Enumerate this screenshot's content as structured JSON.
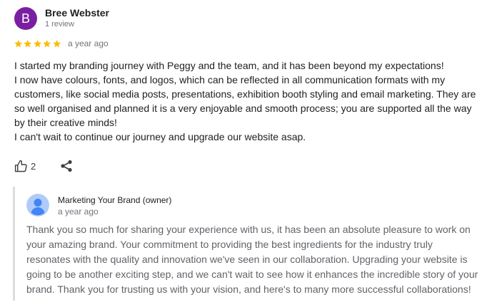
{
  "review": {
    "author": {
      "initial": "B",
      "name": "Bree Webster",
      "meta": "1 review",
      "avatar_color": "#7b1fa2"
    },
    "rating": {
      "value": 5,
      "max": 5,
      "star_color": "#fbbc04"
    },
    "date": "a year ago",
    "text_lines": [
      "I started my branding journey with Peggy and the team, and it has been beyond my expectations!",
      "I now have colours, fonts, and logos, which can be reflected in all communication formats with my",
      "customers, like social media posts, presentations, exhibition booth styling and email marketing. They are",
      "so well organised and planned it is a very enjoyable and smooth process; you are supported all the way",
      "by their creative minds!",
      "I can't wait to continue our journey and upgrade our website asap."
    ],
    "actions": {
      "like_icon": "thumbs-up-icon",
      "like_count": "2",
      "share_icon": "share-icon"
    }
  },
  "owner_reply": {
    "name": "Marketing Your Brand (owner)",
    "date": "a year ago",
    "avatar_icon": "person-icon",
    "text_lines": [
      "Thank you so much for sharing your experience with us, it has been an absolute pleasure to work on",
      "your amazing brand. Your commitment to providing the best ingredients for the industry truly",
      "resonates with the quality and innovation we've seen in our collaboration. Upgrading your website is",
      "going to be another exciting step, and we can't wait to see how it enhances the incredible story of your",
      "brand. Thank you for trusting us with your vision, and here's to many more successful collaborations!"
    ]
  }
}
